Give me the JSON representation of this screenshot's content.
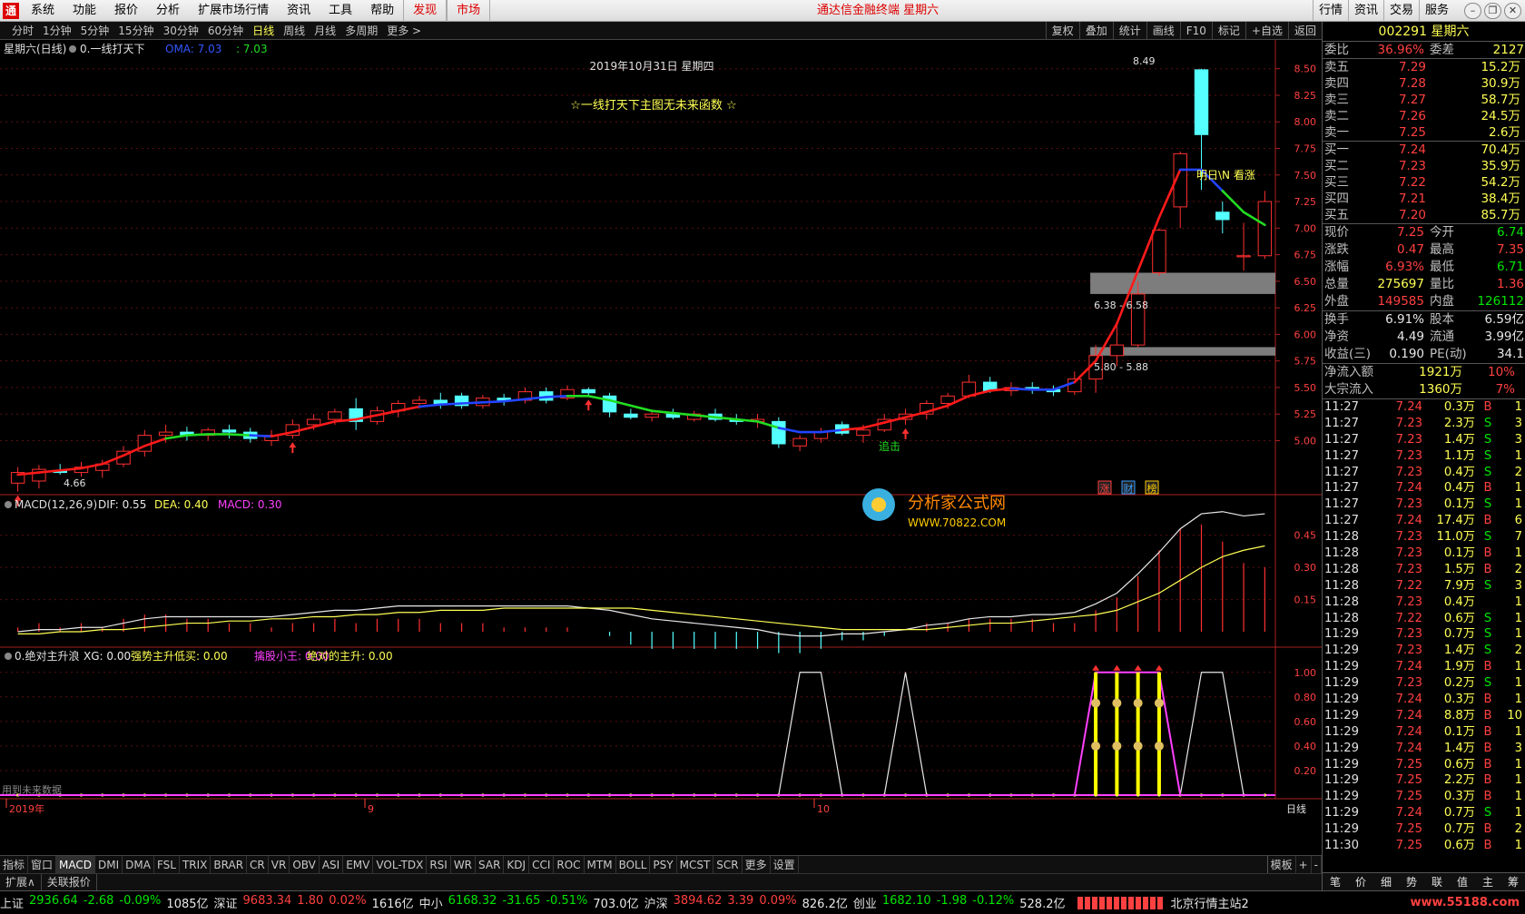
{
  "app": {
    "logo": "通",
    "title": "通达信金融终端 星期六",
    "menus": [
      "系统",
      "功能",
      "报价",
      "分析",
      "扩展市场行情",
      "资讯",
      "工具",
      "帮助"
    ],
    "menus_red": [
      "发现",
      "市场"
    ],
    "right_menus": [
      "行情",
      "资讯",
      "交易",
      "服务"
    ],
    "win_icons": [
      "minimize-icon",
      "restore-icon",
      "close-icon"
    ]
  },
  "toolbar": {
    "periods": [
      "分时",
      "1分钟",
      "5分钟",
      "15分钟",
      "30分钟",
      "60分钟",
      "日线",
      "周线",
      "月线",
      "多周期",
      "更多 >"
    ],
    "selected": "日线",
    "right": [
      "复权",
      "叠加",
      "统计",
      "画线",
      "F10",
      "标记",
      "+自选",
      "返回"
    ]
  },
  "main": {
    "title": "星期六(日线)",
    "indicator": "0.一线打天下",
    "oma_label": "OMA: 7.03",
    "oma_val": ": 7.03",
    "date": "2019年10月31日 星期四",
    "slogan": "☆一线打天下主图无未来函数 ☆",
    "note": "明日\\N 看涨",
    "label_zhuiji": "追击",
    "zone1": "6.38 - 6.58",
    "zone2": "5.80 - 5.88",
    "high_label": "8.49",
    "low_label": "4.66",
    "watermark_cn": "分析家公式网",
    "watermark_url": "WWW.70822.COM",
    "tags": [
      "涨",
      "财",
      "榜"
    ],
    "y_ticks": [
      "8.50",
      "8.25",
      "8.00",
      "7.75",
      "7.50",
      "7.25",
      "7.00",
      "6.75",
      "6.50",
      "6.25",
      "6.00",
      "5.75",
      "5.50",
      "5.25",
      "5.00"
    ]
  },
  "macd": {
    "name": "MACD(12,26,9)",
    "dif": "DIF: 0.55",
    "dea": "DEA: 0.40",
    "macd": "MACD: 0.30",
    "y_ticks": [
      "0.45",
      "0.30",
      "0.15"
    ]
  },
  "ind3": {
    "name": "0.绝对主升浪",
    "xg": "XG: 0.00",
    "s1": "强势主升低买: 0.00",
    "s2": "擒股小王: 0.00",
    "s3": "绝对的主升: 0.00",
    "y_ticks": [
      "1.00",
      "0.80",
      "0.60",
      "0.40",
      "0.20"
    ],
    "future_note": "用到未来数据"
  },
  "xaxis": {
    "labels": [
      "2019年",
      "9",
      "10"
    ],
    "right": "日线"
  },
  "indicator_tabs": [
    "指标",
    "窗口",
    "MACD",
    "DMI",
    "DMA",
    "FSL",
    "TRIX",
    "BRAR",
    "CR",
    "VR",
    "OBV",
    "ASI",
    "EMV",
    "VOL-TDX",
    "RSI",
    "WR",
    "SAR",
    "KDJ",
    "CCI",
    "ROC",
    "MTM",
    "BOLL",
    "PSY",
    "MCST",
    "SCR",
    "更多",
    "设置"
  ],
  "tabs_right": [
    "模板",
    "+",
    "-"
  ],
  "ext_tabs": [
    "扩展∧",
    "关联报价"
  ],
  "quote": {
    "code": "002291",
    "name": "星期六",
    "wb": {
      "l": "委比",
      "v": "36.96%",
      "l2": "委差",
      "v2": "2127"
    },
    "sells": [
      {
        "l": "卖五",
        "p": "7.29",
        "v": "15.2万"
      },
      {
        "l": "卖四",
        "p": "7.28",
        "v": "30.9万"
      },
      {
        "l": "卖三",
        "p": "7.27",
        "v": "58.7万"
      },
      {
        "l": "卖二",
        "p": "7.26",
        "v": "24.5万"
      },
      {
        "l": "卖一",
        "p": "7.25",
        "v": "2.6万"
      }
    ],
    "buys": [
      {
        "l": "买一",
        "p": "7.24",
        "v": "70.4万"
      },
      {
        "l": "买二",
        "p": "7.23",
        "v": "35.9万"
      },
      {
        "l": "买三",
        "p": "7.22",
        "v": "54.2万"
      },
      {
        "l": "买四",
        "p": "7.21",
        "v": "38.4万"
      },
      {
        "l": "买五",
        "p": "7.20",
        "v": "85.7万"
      }
    ],
    "stats": [
      {
        "k1": "现价",
        "v1": "7.25",
        "c1": "red",
        "k2": "今开",
        "v2": "6.74",
        "c2": "green"
      },
      {
        "k1": "涨跌",
        "v1": "0.47",
        "c1": "red",
        "k2": "最高",
        "v2": "7.35",
        "c2": "red"
      },
      {
        "k1": "涨幅",
        "v1": "6.93%",
        "c1": "red",
        "k2": "最低",
        "v2": "6.71",
        "c2": "green"
      },
      {
        "k1": "总量",
        "v1": "275697",
        "c1": "yellow",
        "k2": "量比",
        "v2": "1.36",
        "c2": "red"
      },
      {
        "k1": "外盘",
        "v1": "149585",
        "c1": "red",
        "k2": "内盘",
        "v2": "126112",
        "c2": "green"
      }
    ],
    "stats2": [
      {
        "k1": "换手",
        "v1": "6.91%",
        "c1": "white",
        "k2": "股本",
        "v2": "6.59亿",
        "c2": "white"
      },
      {
        "k1": "净资",
        "v1": "4.49",
        "c1": "white",
        "k2": "流通",
        "v2": "3.99亿",
        "c2": "white"
      },
      {
        "k1": "收益(三)",
        "v1": "0.190",
        "c1": "white",
        "k2": "PE(动)",
        "v2": "34.1",
        "c2": "white"
      }
    ],
    "flows": [
      {
        "k": "净流入额",
        "v": "1921万",
        "p": "10%"
      },
      {
        "k": "大宗流入",
        "v": "1360万",
        "p": "7%"
      }
    ],
    "ticks": [
      {
        "t": "11:27",
        "p": "7.24",
        "v": "0.3万",
        "d": "B",
        "n": "1"
      },
      {
        "t": "11:27",
        "p": "7.23",
        "v": "2.3万",
        "d": "S",
        "n": "3"
      },
      {
        "t": "11:27",
        "p": "7.23",
        "v": "1.4万",
        "d": "S",
        "n": "3"
      },
      {
        "t": "11:27",
        "p": "7.23",
        "v": "1.1万",
        "d": "S",
        "n": "1"
      },
      {
        "t": "11:27",
        "p": "7.23",
        "v": "0.4万",
        "d": "S",
        "n": "2"
      },
      {
        "t": "11:27",
        "p": "7.24",
        "v": "0.4万",
        "d": "B",
        "n": "1"
      },
      {
        "t": "11:27",
        "p": "7.23",
        "v": "0.1万",
        "d": "S",
        "n": "1"
      },
      {
        "t": "11:27",
        "p": "7.24",
        "v": "17.4万",
        "d": "B",
        "n": "6"
      },
      {
        "t": "11:28",
        "p": "7.23",
        "v": "11.0万",
        "d": "S",
        "n": "7"
      },
      {
        "t": "11:28",
        "p": "7.23",
        "v": "0.1万",
        "d": "B",
        "n": "1"
      },
      {
        "t": "11:28",
        "p": "7.23",
        "v": "1.5万",
        "d": "B",
        "n": "2"
      },
      {
        "t": "11:28",
        "p": "7.22",
        "v": "7.9万",
        "d": "S",
        "n": "3"
      },
      {
        "t": "11:28",
        "p": "7.23",
        "v": "0.4万",
        "d": "",
        "n": "1"
      },
      {
        "t": "11:28",
        "p": "7.22",
        "v": "0.6万",
        "d": "S",
        "n": "1"
      },
      {
        "t": "11:29",
        "p": "7.23",
        "v": "0.7万",
        "d": "S",
        "n": "1"
      },
      {
        "t": "11:29",
        "p": "7.23",
        "v": "1.4万",
        "d": "S",
        "n": "2"
      },
      {
        "t": "11:29",
        "p": "7.24",
        "v": "1.9万",
        "d": "B",
        "n": "1"
      },
      {
        "t": "11:29",
        "p": "7.23",
        "v": "0.2万",
        "d": "S",
        "n": "1"
      },
      {
        "t": "11:29",
        "p": "7.24",
        "v": "0.3万",
        "d": "B",
        "n": "1"
      },
      {
        "t": "11:29",
        "p": "7.24",
        "v": "8.8万",
        "d": "B",
        "n": "10"
      },
      {
        "t": "11:29",
        "p": "7.24",
        "v": "0.1万",
        "d": "B",
        "n": "1"
      },
      {
        "t": "11:29",
        "p": "7.24",
        "v": "1.4万",
        "d": "B",
        "n": "3"
      },
      {
        "t": "11:29",
        "p": "7.25",
        "v": "0.6万",
        "d": "B",
        "n": "1"
      },
      {
        "t": "11:29",
        "p": "7.25",
        "v": "2.2万",
        "d": "B",
        "n": "1"
      },
      {
        "t": "11:29",
        "p": "7.25",
        "v": "0.3万",
        "d": "B",
        "n": "1"
      },
      {
        "t": "11:29",
        "p": "7.24",
        "v": "0.7万",
        "d": "S",
        "n": "1"
      },
      {
        "t": "11:29",
        "p": "7.25",
        "v": "0.7万",
        "d": "B",
        "n": "2"
      },
      {
        "t": "11:30",
        "p": "7.25",
        "v": "0.6万",
        "d": "B",
        "n": "1"
      }
    ],
    "bottom_tabs": [
      "笔",
      "价",
      "细",
      "势",
      "联",
      "值",
      "主",
      "筹"
    ]
  },
  "status": [
    {
      "n": "上证",
      "v": "2936.64",
      "c": "-2.68",
      "p": "-0.09%",
      "a": "1085亿"
    },
    {
      "n": "深证",
      "v": "9683.34",
      "c": "1.80",
      "p": "0.02%",
      "a": "1616亿"
    },
    {
      "n": "中小",
      "v": "6168.32",
      "c": "-31.65",
      "p": "-0.51%",
      "a": "703.0亿"
    },
    {
      "n": "沪深",
      "v": "3894.62",
      "c": "3.39",
      "p": "0.09%",
      "a": "826.2亿"
    },
    {
      "n": "创业",
      "v": "1682.10",
      "c": "-1.98",
      "p": "-0.12%",
      "a": "528.2亿"
    }
  ],
  "status_right": "北京行情主站2",
  "watermark2": "www.55188.com",
  "chart_data": {
    "type": "candlestick",
    "ohlc": [
      [
        4.6,
        4.75,
        4.52,
        4.7
      ],
      [
        4.62,
        4.77,
        4.55,
        4.73
      ],
      [
        4.72,
        4.78,
        4.68,
        4.7
      ],
      [
        4.7,
        4.8,
        4.66,
        4.75
      ],
      [
        4.72,
        4.82,
        4.65,
        4.78
      ],
      [
        4.78,
        4.95,
        4.75,
        4.9
      ],
      [
        4.9,
        5.1,
        4.85,
        5.05
      ],
      [
        5.05,
        5.15,
        4.98,
        5.08
      ],
      [
        5.08,
        5.13,
        5.0,
        5.05
      ],
      [
        5.05,
        5.12,
        5.0,
        5.1
      ],
      [
        5.1,
        5.15,
        5.02,
        5.08
      ],
      [
        5.08,
        5.12,
        4.98,
        5.02
      ],
      [
        5.0,
        5.1,
        4.95,
        5.05
      ],
      [
        5.05,
        5.2,
        5.02,
        5.15
      ],
      [
        5.15,
        5.25,
        5.1,
        5.2
      ],
      [
        5.2,
        5.3,
        5.15,
        5.27
      ],
      [
        5.3,
        5.4,
        5.1,
        5.18
      ],
      [
        5.18,
        5.32,
        5.15,
        5.28
      ],
      [
        5.28,
        5.38,
        5.22,
        5.35
      ],
      [
        5.35,
        5.42,
        5.3,
        5.38
      ],
      [
        5.38,
        5.45,
        5.3,
        5.35
      ],
      [
        5.42,
        5.45,
        5.3,
        5.33
      ],
      [
        5.33,
        5.43,
        5.3,
        5.4
      ],
      [
        5.4,
        5.44,
        5.33,
        5.38
      ],
      [
        5.38,
        5.5,
        5.35,
        5.46
      ],
      [
        5.46,
        5.5,
        5.35,
        5.38
      ],
      [
        5.4,
        5.52,
        5.38,
        5.48
      ],
      [
        5.48,
        5.5,
        5.42,
        5.45
      ],
      [
        5.42,
        5.45,
        5.22,
        5.27
      ],
      [
        5.25,
        5.3,
        5.2,
        5.22
      ],
      [
        5.22,
        5.28,
        5.18,
        5.25
      ],
      [
        5.25,
        5.3,
        5.2,
        5.22
      ],
      [
        5.2,
        5.28,
        5.18,
        5.25
      ],
      [
        5.25,
        5.3,
        5.18,
        5.2
      ],
      [
        5.2,
        5.25,
        5.15,
        5.18
      ],
      [
        5.18,
        5.25,
        5.12,
        5.2
      ],
      [
        5.18,
        5.22,
        4.93,
        4.97
      ],
      [
        4.95,
        5.05,
        4.9,
        5.02
      ],
      [
        5.02,
        5.12,
        4.98,
        5.08
      ],
      [
        5.15,
        5.18,
        5.05,
        5.07
      ],
      [
        5.05,
        5.15,
        4.98,
        5.1
      ],
      [
        5.1,
        5.25,
        5.08,
        5.2
      ],
      [
        5.2,
        5.3,
        5.15,
        5.25
      ],
      [
        5.25,
        5.38,
        5.2,
        5.35
      ],
      [
        5.35,
        5.45,
        5.3,
        5.42
      ],
      [
        5.42,
        5.62,
        5.4,
        5.55
      ],
      [
        5.55,
        5.6,
        5.45,
        5.47
      ],
      [
        5.47,
        5.55,
        5.42,
        5.5
      ],
      [
        5.5,
        5.55,
        5.44,
        5.48
      ],
      [
        5.48,
        5.52,
        5.42,
        5.46
      ],
      [
        5.46,
        5.65,
        5.43,
        5.58
      ],
      [
        5.58,
        5.9,
        5.45,
        5.8
      ],
      [
        5.8,
        6.12,
        5.7,
        5.9
      ],
      [
        5.9,
        6.5,
        5.88,
        6.38
      ],
      [
        6.58,
        7.0,
        6.55,
        6.98
      ],
      [
        7.2,
        7.72,
        7.0,
        7.7
      ],
      [
        8.49,
        8.5,
        7.36,
        7.88
      ],
      [
        7.15,
        7.25,
        6.95,
        7.08
      ],
      [
        6.74,
        7.05,
        6.6,
        6.74
      ],
      [
        6.74,
        7.35,
        6.71,
        7.25
      ]
    ],
    "oma": [
      4.68,
      4.7,
      4.72,
      4.74,
      4.78,
      4.86,
      4.95,
      5.02,
      5.05,
      5.06,
      5.06,
      5.05,
      5.04,
      5.08,
      5.13,
      5.18,
      5.2,
      5.24,
      5.28,
      5.32,
      5.34,
      5.35,
      5.36,
      5.37,
      5.39,
      5.41,
      5.42,
      5.42,
      5.38,
      5.33,
      5.28,
      5.26,
      5.24,
      5.22,
      5.2,
      5.18,
      5.12,
      5.08,
      5.08,
      5.1,
      5.12,
      5.17,
      5.22,
      5.27,
      5.33,
      5.42,
      5.47,
      5.49,
      5.48,
      5.48,
      5.55,
      5.75,
      6.1,
      6.6,
      7.1,
      7.55,
      7.55,
      7.35,
      7.15,
      7.03
    ],
    "oma_trend": [
      "r",
      "r",
      "r",
      "r",
      "r",
      "r",
      "r",
      "r",
      "g",
      "g",
      "g",
      "g",
      "b",
      "r",
      "r",
      "r",
      "r",
      "r",
      "r",
      "r",
      "b",
      "b",
      "b",
      "b",
      "b",
      "b",
      "b",
      "g",
      "g",
      "g",
      "g",
      "g",
      "g",
      "g",
      "g",
      "g",
      "g",
      "b",
      "b",
      "b",
      "r",
      "r",
      "r",
      "r",
      "r",
      "r",
      "r",
      "r",
      "b",
      "b",
      "b",
      "r",
      "r",
      "r",
      "r",
      "r",
      "b",
      "b",
      "g",
      "g"
    ],
    "dif": [
      0.0,
      0.01,
      0.01,
      0.02,
      0.02,
      0.04,
      0.06,
      0.07,
      0.07,
      0.07,
      0.07,
      0.07,
      0.07,
      0.08,
      0.09,
      0.1,
      0.1,
      0.11,
      0.12,
      0.12,
      0.12,
      0.12,
      0.12,
      0.12,
      0.12,
      0.12,
      0.12,
      0.11,
      0.1,
      0.08,
      0.06,
      0.05,
      0.04,
      0.03,
      0.02,
      0.01,
      -0.01,
      -0.02,
      -0.02,
      -0.01,
      -0.01,
      0.0,
      0.01,
      0.03,
      0.04,
      0.06,
      0.07,
      0.07,
      0.08,
      0.08,
      0.09,
      0.13,
      0.18,
      0.27,
      0.37,
      0.48,
      0.55,
      0.56,
      0.54,
      0.55
    ],
    "dea": [
      -0.01,
      -0.01,
      0.0,
      0.0,
      0.01,
      0.01,
      0.02,
      0.03,
      0.04,
      0.04,
      0.05,
      0.05,
      0.06,
      0.06,
      0.07,
      0.07,
      0.08,
      0.08,
      0.09,
      0.09,
      0.1,
      0.1,
      0.1,
      0.11,
      0.11,
      0.11,
      0.11,
      0.11,
      0.11,
      0.11,
      0.1,
      0.09,
      0.08,
      0.07,
      0.06,
      0.05,
      0.04,
      0.03,
      0.02,
      0.01,
      0.01,
      0.01,
      0.01,
      0.01,
      0.02,
      0.03,
      0.04,
      0.04,
      0.05,
      0.06,
      0.07,
      0.08,
      0.1,
      0.14,
      0.18,
      0.24,
      0.3,
      0.35,
      0.38,
      0.4
    ],
    "zones": [
      [
        6.38,
        6.58
      ],
      [
        5.8,
        5.88
      ]
    ],
    "signal": [
      0,
      0,
      0,
      0,
      0,
      0,
      0,
      0,
      0,
      0,
      0,
      0,
      0,
      0,
      0,
      0,
      0,
      0,
      0,
      0,
      0,
      0,
      0,
      0,
      0,
      0,
      0,
      0,
      0,
      0,
      0,
      0,
      0,
      0,
      0,
      0,
      0,
      1,
      1,
      0,
      0,
      0,
      1,
      0,
      0,
      0,
      0,
      0,
      0,
      0,
      0,
      1,
      1,
      1,
      1,
      0,
      1,
      1,
      0,
      0
    ],
    "signal2": [
      0,
      0,
      0,
      0,
      0,
      0,
      0,
      0,
      0,
      0,
      0,
      0,
      0,
      0,
      0,
      0,
      0,
      0,
      0,
      0,
      0,
      0,
      0,
      0,
      0,
      0,
      0,
      0,
      0,
      0,
      0,
      0,
      0,
      0,
      0,
      0,
      0,
      0,
      0,
      0,
      0,
      0,
      0,
      0,
      0,
      0,
      0,
      0,
      0,
      0,
      0,
      1,
      1,
      1,
      1,
      0,
      0,
      0,
      0,
      0
    ],
    "ylim": [
      4.5,
      8.6
    ]
  }
}
